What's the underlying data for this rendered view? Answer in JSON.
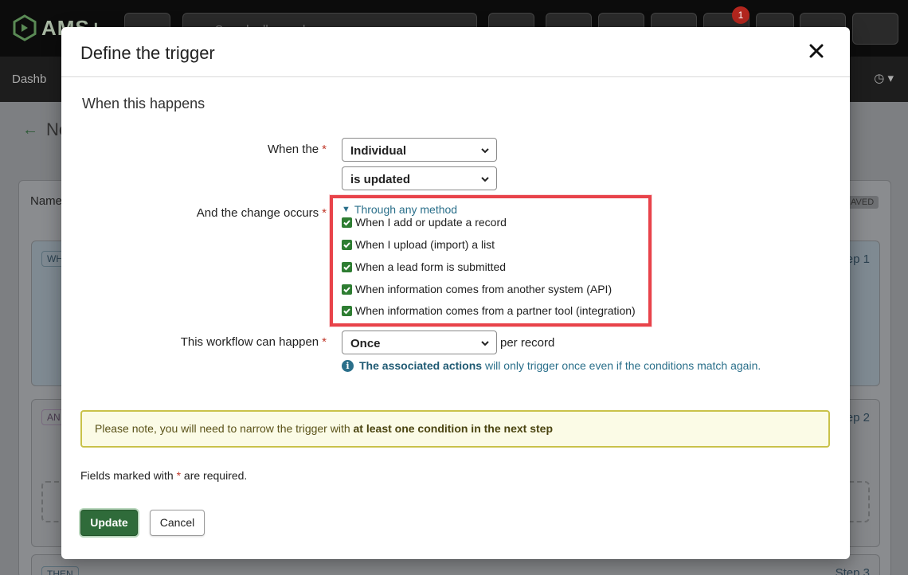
{
  "app": {
    "logo_text": "AMS+",
    "search_placeholder": "Search all records",
    "notification_count": "1",
    "nav_item": "Dashb",
    "page_title_fragment": "Ne",
    "panel_name_label": "Name",
    "saved_badge": "AVED",
    "cards": [
      {
        "chip": "WH",
        "step": "ep 1"
      },
      {
        "chip": "AN",
        "step": "ep 2"
      },
      {
        "chip": "THEN",
        "step": "Step 3"
      }
    ]
  },
  "modal": {
    "title": "Define the trigger",
    "section_title": "When this happens",
    "when_the_label": "When the",
    "required_mark": "*",
    "when_the_value": "Individual",
    "action_value": "is updated",
    "change_occurs_label": "And the change occurs",
    "method_toggle": "Through any method",
    "methods": [
      "When I add or update a record",
      "When I upload (import) a list",
      "When a lead form is submitted",
      "When information comes from another system (API)",
      "When information comes from a partner tool (integration)"
    ],
    "frequency_label": "This workflow can happen",
    "frequency_value": "Once",
    "per_record": "per record",
    "info_strong": "The associated actions",
    "info_rest": "will only trigger once even if the conditions match again.",
    "note_text": "Please note, you will need to narrow the trigger with ",
    "note_strong": "at least one condition in the next step",
    "required_note_before": "Fields marked with ",
    "required_note_after": " are required.",
    "update_label": "Update",
    "cancel_label": "Cancel"
  },
  "colors": {
    "primary_green": "#2f6b3a",
    "highlight_red": "#e8434a",
    "info_blue": "#2a6f8a",
    "note_bg": "#fbfbe6"
  }
}
